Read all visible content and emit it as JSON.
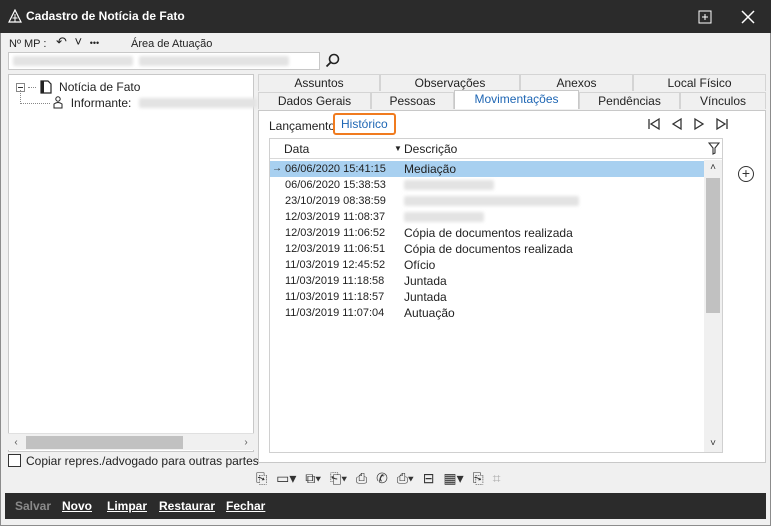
{
  "window": {
    "title": "Cadastro de Notícia de Fato",
    "minimize": "⊟",
    "close": "✕"
  },
  "form": {
    "nmp_label": "Nº MP :",
    "area_label": "Área de Atuação",
    "nav_back": "↶",
    "nav_down": "˅",
    "nav_more": "•••"
  },
  "tree": {
    "root_label": "Notícia de Fato",
    "child_label": "Informante:"
  },
  "copiar_label": "Copiar repres./advogado para outras partes",
  "tabs_row1": [
    "Assuntos",
    "Observações",
    "Anexos",
    "Local Físico"
  ],
  "tabs_row2": [
    "Dados Gerais",
    "Pessoas",
    "Movimentações",
    "Pendências",
    "Vínculos"
  ],
  "active_tab": "Movimentações",
  "subtabs": {
    "lancamento": "Lançamento",
    "historico": "Histórico"
  },
  "grid": {
    "col_data": "Data",
    "col_descricao": "Descrição",
    "rows": [
      {
        "data": "06/06/2020 15:41:15",
        "descricao": "Mediação",
        "selected": true
      },
      {
        "data": "06/06/2020 15:38:53",
        "descricao": ""
      },
      {
        "data": "23/10/2019 08:38:59",
        "descricao": ""
      },
      {
        "data": "12/03/2019 11:08:37",
        "descricao": ""
      },
      {
        "data": "12/03/2019 11:06:52",
        "descricao": "Cópia de documentos realizada"
      },
      {
        "data": "12/03/2019 11:06:51",
        "descricao": "Cópia de documentos realizada"
      },
      {
        "data": "11/03/2019 12:45:52",
        "descricao": "Ofício"
      },
      {
        "data": "11/03/2019 11:18:58",
        "descricao": "Juntada"
      },
      {
        "data": "11/03/2019 11:18:57",
        "descricao": "Juntada"
      },
      {
        "data": "11/03/2019 11:07:04",
        "descricao": "Autuação"
      }
    ]
  },
  "bottom": {
    "salvar": "Salvar",
    "novo": "Novo",
    "limpar": "Limpar",
    "restaurar": "Restaurar",
    "fechar": "Fechar"
  },
  "colors": {
    "titlebar": "#2b2b2b",
    "accent": "#1e66b4",
    "highlight": "#f07b1f",
    "selection": "#a8d0f0"
  }
}
